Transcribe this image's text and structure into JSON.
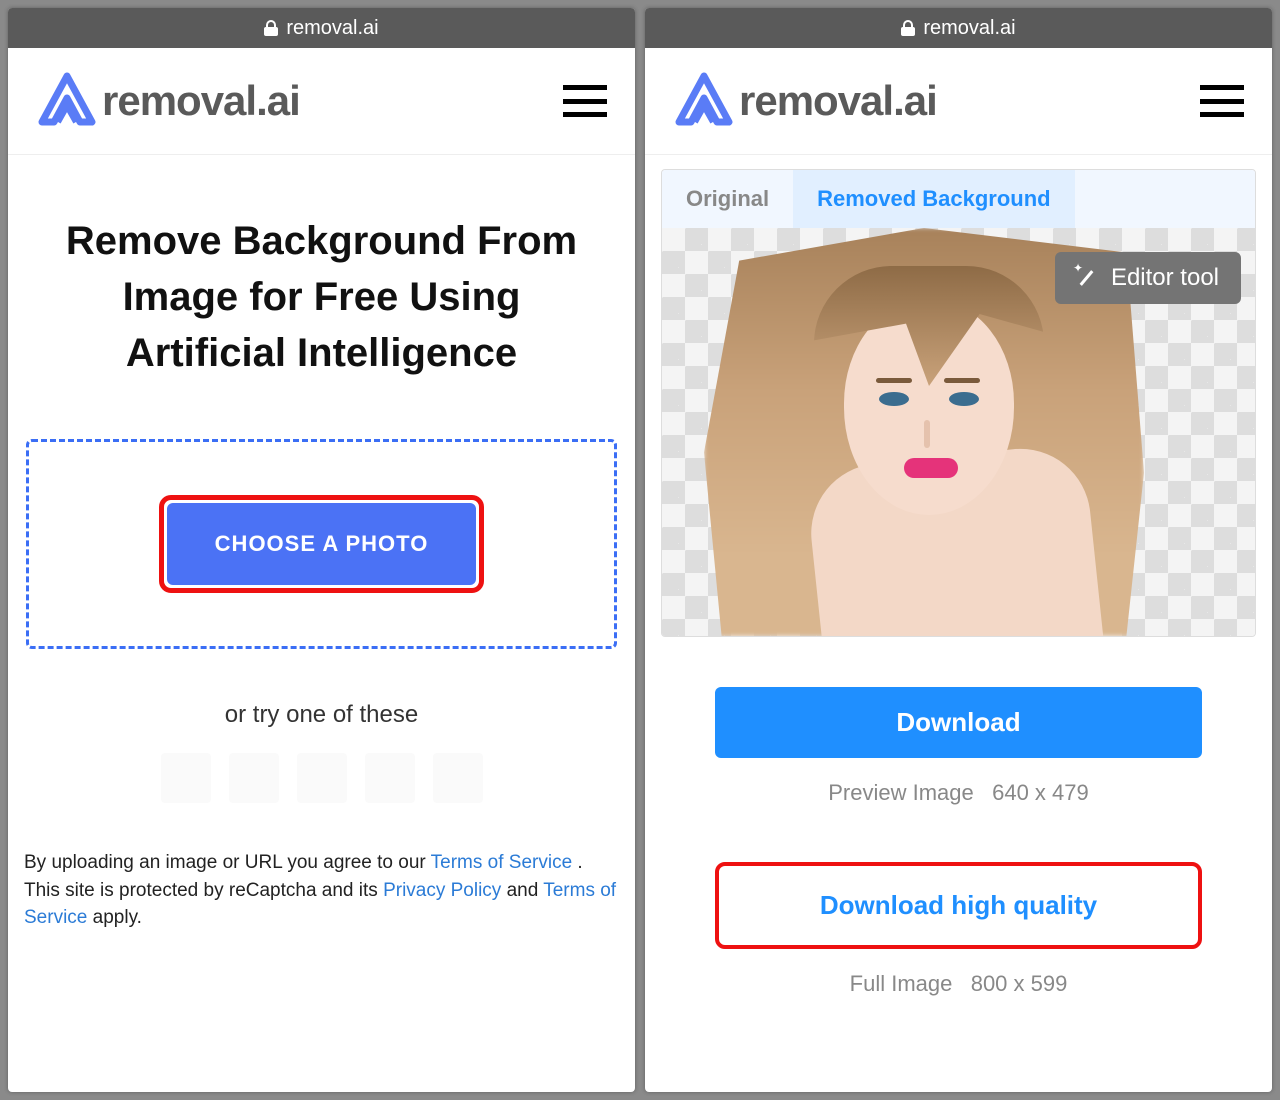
{
  "left": {
    "url": "removal.ai",
    "brand": "removal.ai",
    "headline": "Remove Background From Image for Free Using Artificial Intelligence",
    "choose_label": "CHOOSE A PHOTO",
    "or_label": "or try one of these",
    "legal_pre": "By uploading an image or URL you agree to our ",
    "tos1": "Terms of Service",
    "legal_mid1": " . This site is protected by reCaptcha and its ",
    "privacy": "Privacy Policy",
    "legal_mid2": " and ",
    "tos2": "Terms of Service",
    "legal_post": " apply."
  },
  "right": {
    "url": "removal.ai",
    "brand": "removal.ai",
    "tabs": {
      "original": "Original",
      "removed": "Removed Background"
    },
    "editor_label": "Editor tool",
    "download_label": "Download",
    "preview_label": "Preview Image",
    "preview_dim": "640 x 479",
    "download_hq_label": "Download high quality",
    "full_label": "Full Image",
    "full_dim": "800 x 599"
  }
}
